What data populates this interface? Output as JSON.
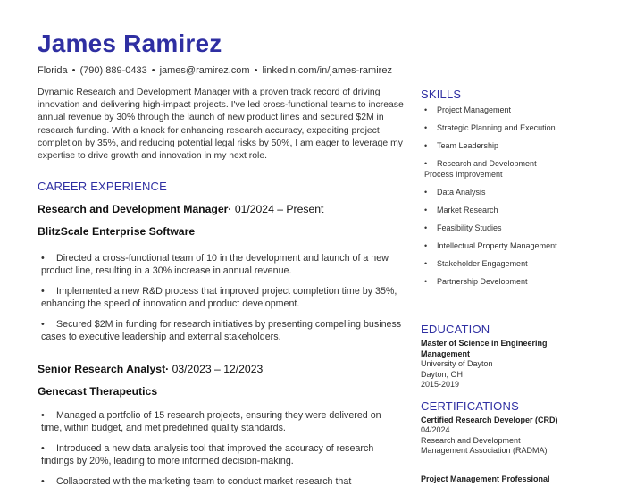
{
  "header": {
    "name": "James Ramirez",
    "location": "Florida",
    "phone": "(790) 889-0433",
    "email": "james@ramirez.com",
    "linkedin": "linkedin.com/in/james-ramirez",
    "separator": "•"
  },
  "summary": "Dynamic Research and Development Manager with a proven track record of driving innovation and delivering high-impact projects. I've led cross-functional teams to increase annual revenue by 30% through the launch of new product lines and secured $2M in research funding. With a knack for enhancing research accuracy, expediting project completion by 35%, and reducing potential legal risks by 50%, I am eager to leverage my expertise to drive growth and innovation in my next role.",
  "career": {
    "title": "CAREER EXPERIENCE",
    "jobs": [
      {
        "role": "Research and Development Manager",
        "dates": "01/2024 – Present",
        "company": "BlitzScale Enterprise Software",
        "bullets": [
          "Directed a cross-functional team of 10 in the development and launch of a new product line, resulting in a 30% increase in annual revenue.",
          "Implemented a new R&D process that improved project completion time by 35%, enhancing the speed of innovation and product development.",
          "Secured $2M in funding for research initiatives by presenting compelling business cases to executive leadership and external stakeholders."
        ]
      },
      {
        "role": "Senior Research Analyst",
        "dates": "03/2023 – 12/2023",
        "company": "Genecast Therapeutics",
        "bullets": [
          "Managed a portfolio of 15 research projects, ensuring they were delivered on time, within budget, and met predefined quality standards.",
          "Introduced a new data analysis tool that improved the accuracy of research findings by 20%, leading to more informed decision-making.",
          "Collaborated with the marketing team to conduct market research that"
        ]
      }
    ]
  },
  "bullet_char": "•",
  "skills": {
    "title": "SKILLS",
    "items": [
      "Project Management",
      "Strategic Planning and Execution",
      "Team Leadership",
      "Research and Development Process Improvement",
      "Data Analysis",
      "Market Research",
      "Feasibility Studies",
      "Intellectual Property Management",
      "Stakeholder Engagement",
      "Partnership Development"
    ]
  },
  "education": {
    "title": "EDUCATION",
    "degree": "Master of Science in Engineering Management",
    "school": "University of Dayton",
    "location": "Dayton, OH",
    "dates": "2015-2019"
  },
  "certifications": {
    "title": "CERTIFICATIONS",
    "items": [
      {
        "name": "Certified Research Developer (CRD)",
        "date": "04/2024",
        "issuer": "Research and Development Management Association (RADMA)"
      },
      {
        "name": "Project Management Professional"
      }
    ]
  },
  "colors": {
    "accent": "#2f2fa2",
    "text": "#333333"
  }
}
